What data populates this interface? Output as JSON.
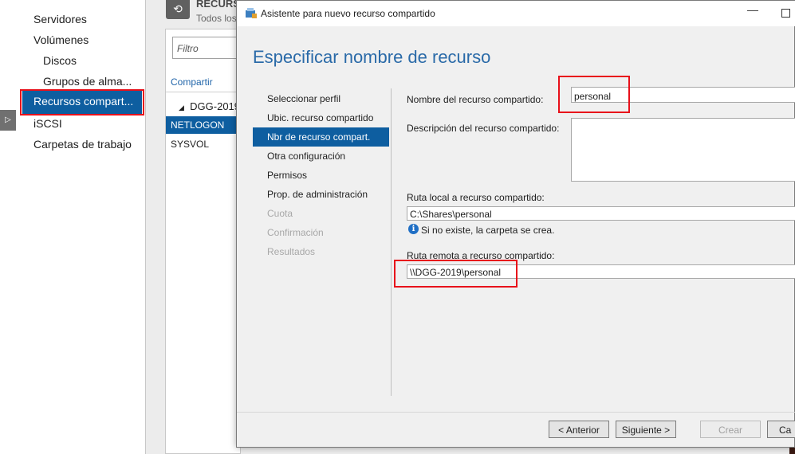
{
  "nav": {
    "items": [
      {
        "label": "Servidores"
      },
      {
        "label": "Volúmenes"
      },
      {
        "label": "Discos"
      },
      {
        "label": "Grupos de alma..."
      },
      {
        "label": "Recursos compart..."
      },
      {
        "label": "iSCSI"
      },
      {
        "label": "Carpetas de trabajo"
      }
    ]
  },
  "shares_panel": {
    "title": "RECURS",
    "subtitle": "Todos los",
    "filter_placeholder": "Filtro",
    "column_header": "Compartir",
    "group": "DGG-2019",
    "rows": [
      "NETLOGON",
      "SYSVOL"
    ]
  },
  "dialog": {
    "title": "Asistente para nuevo recurso compartido",
    "heading": "Especificar nombre de recurso",
    "steps": [
      {
        "label": "Seleccionar perfil",
        "state": "normal"
      },
      {
        "label": "Ubic. recurso compartido",
        "state": "normal"
      },
      {
        "label": "Nbr de recurso compart.",
        "state": "current"
      },
      {
        "label": "Otra configuración",
        "state": "normal"
      },
      {
        "label": "Permisos",
        "state": "normal"
      },
      {
        "label": "Prop. de administración",
        "state": "normal"
      },
      {
        "label": "Cuota",
        "state": "disabled"
      },
      {
        "label": "Confirmación",
        "state": "disabled"
      },
      {
        "label": "Resultados",
        "state": "disabled"
      }
    ],
    "share_name_label": "Nombre del recurso compartido:",
    "share_name_value": "personal",
    "description_label": "Descripción del recurso compartido:",
    "description_value": "",
    "local_path_label": "Ruta local a recurso compartido:",
    "local_path_value": "C:\\Shares\\personal",
    "info_text": "Si no existe, la carpeta se crea.",
    "remote_path_label": "Ruta remota a recurso compartido:",
    "remote_path_value": "\\\\DGG-2019\\personal",
    "buttons": {
      "back": "< Anterior",
      "next": "Siguiente >",
      "create": "Crear",
      "cancel": "Ca"
    }
  },
  "colors": {
    "selection_blue": "#0e5ea0",
    "heading_blue": "#2a6aa8",
    "highlight_red": "#e8101a"
  }
}
